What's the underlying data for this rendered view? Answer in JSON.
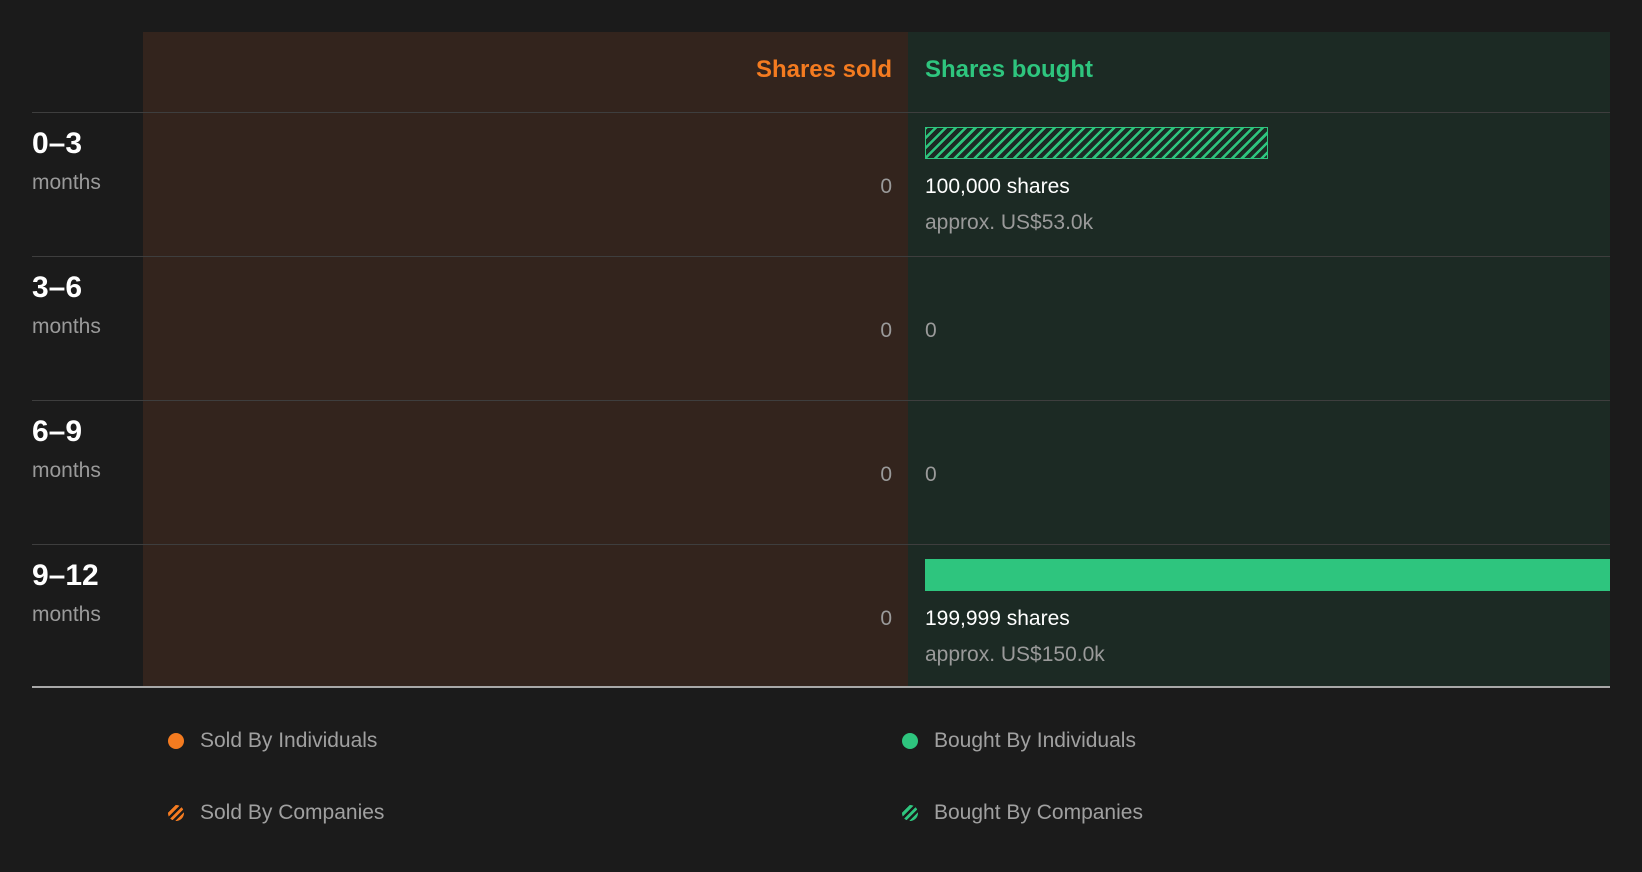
{
  "chart_data": {
    "type": "bar",
    "columns": {
      "sold": "Shares sold",
      "bought": "Shares bought"
    },
    "categories": [
      {
        "period": "0–3",
        "unit": "months"
      },
      {
        "period": "3–6",
        "unit": "months"
      },
      {
        "period": "6–9",
        "unit": "months"
      },
      {
        "period": "9–12",
        "unit": "months"
      }
    ],
    "sold": [
      {
        "value": 0,
        "label": "0"
      },
      {
        "value": 0,
        "label": "0"
      },
      {
        "value": 0,
        "label": "0"
      },
      {
        "value": 0,
        "label": "0"
      }
    ],
    "bought": [
      {
        "value": 100000,
        "label": "100,000 shares",
        "approx": "approx. US$53.0k",
        "source": "companies",
        "zero_label": ""
      },
      {
        "value": 0,
        "label": "",
        "approx": "",
        "source": "",
        "zero_label": "0"
      },
      {
        "value": 0,
        "label": "",
        "approx": "",
        "source": "",
        "zero_label": "0"
      },
      {
        "value": 199999,
        "label": "199,999 shares",
        "approx": "approx. US$150.0k",
        "source": "individuals",
        "zero_label": ""
      }
    ],
    "max_value": 199999,
    "legend": [
      {
        "label": "Sold By Individuals",
        "color": "#f47b20",
        "pattern": "solid"
      },
      {
        "label": "Bought By Individuals",
        "color": "#2ec57e",
        "pattern": "solid"
      },
      {
        "label": "Sold By Companies",
        "color": "#f47b20",
        "pattern": "hatched"
      },
      {
        "label": "Bought By Companies",
        "color": "#2ec57e",
        "pattern": "hatched"
      }
    ],
    "legend_placement": "bottom"
  },
  "colors": {
    "sold": "#f47b20",
    "bought": "#2ec57e",
    "sold_panel": "#33241d",
    "bought_panel": "#1c2a24",
    "background": "#1b1b1b"
  }
}
